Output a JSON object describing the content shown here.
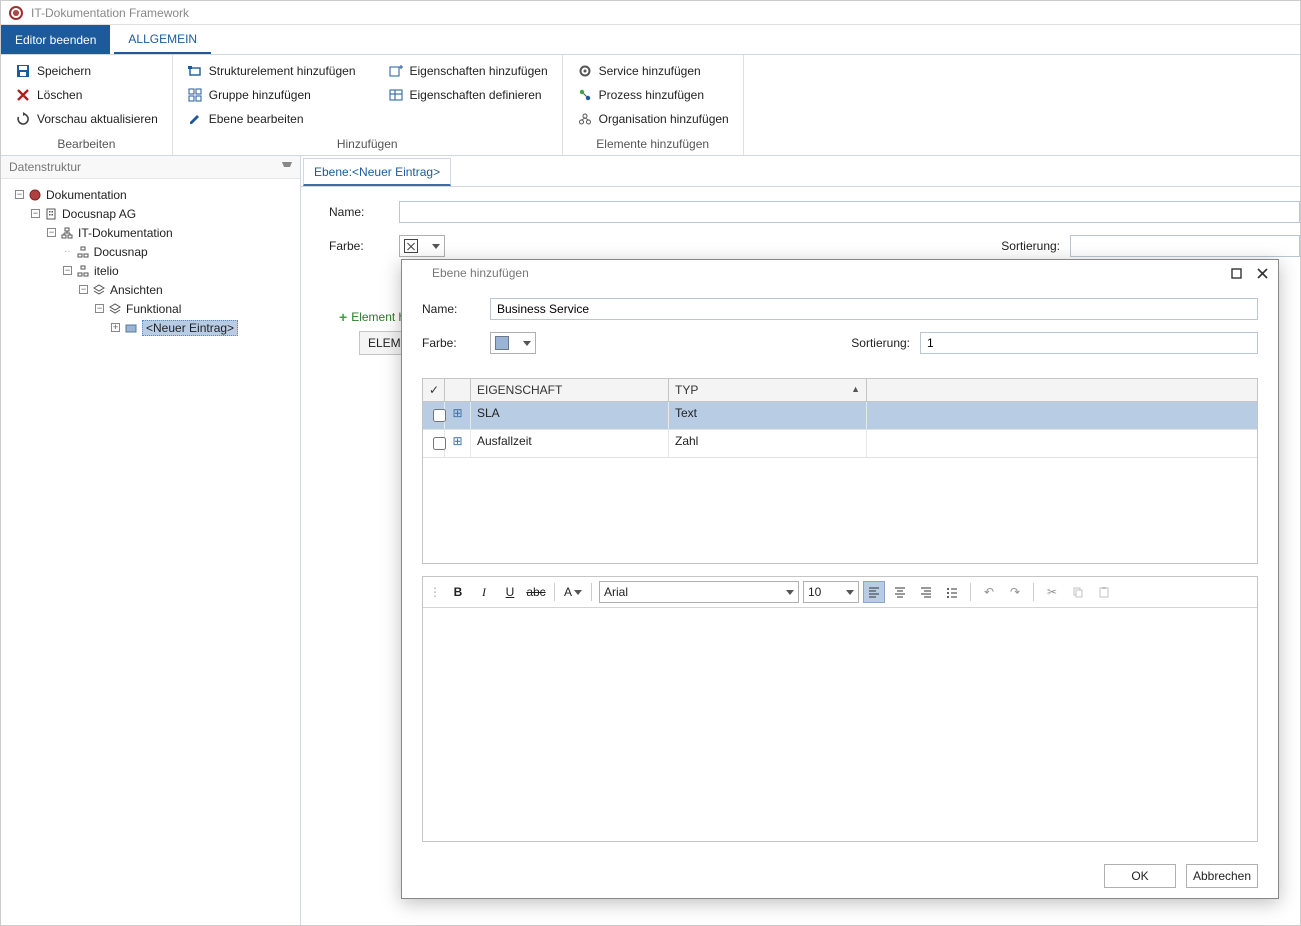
{
  "app_title": "IT-Dokumentation Framework",
  "tabs": {
    "editor_exit": "Editor beenden",
    "general": "ALLGEMEIN"
  },
  "ribbon": {
    "edit_group": {
      "label": "Bearbeiten",
      "save": "Speichern",
      "delete": "Löschen",
      "refresh_preview": "Vorschau aktualisieren"
    },
    "add_group": {
      "label": "Hinzufügen",
      "add_structure": "Strukturelement hinzufügen",
      "add_group_item": "Gruppe hinzufügen",
      "edit_layer": "Ebene bearbeiten",
      "add_properties": "Eigenschaften hinzufügen",
      "define_properties": "Eigenschaften definieren"
    },
    "elements_group": {
      "label": "Elemente hinzufügen",
      "add_service": "Service hinzufügen",
      "add_process": "Prozess hinzufügen",
      "add_org": "Organisation hinzufügen"
    }
  },
  "sidebar": {
    "title": "Datenstruktur",
    "tree": {
      "root": "Dokumentation",
      "company": "Docusnap AG",
      "itdoc": "IT-Dokumentation",
      "docusnap": "Docusnap",
      "itelio": "itelio",
      "views": "Ansichten",
      "functional": "Funktional",
      "new_entry": "<Neuer Eintrag>"
    }
  },
  "editor": {
    "tab_label_prefix": "Ebene: ",
    "tab_entry": "<Neuer Eintrag>",
    "name_label": "Name:",
    "color_label": "Farbe:",
    "sort_label": "Sortierung:",
    "add_element": "Element hinzufügen",
    "grid_col": "ELEMENT"
  },
  "dialog": {
    "title": "Ebene hinzufügen",
    "name_label": "Name:",
    "name_value": "Business Service",
    "color_label": "Farbe:",
    "sort_label": "Sortierung:",
    "sort_value": "1",
    "table": {
      "col_property": "EIGENSCHAFT",
      "col_type": "TYP",
      "rows": [
        {
          "property": "SLA",
          "type": "Text",
          "selected": true
        },
        {
          "property": "Ausfallzeit",
          "type": "Zahl",
          "selected": false
        }
      ]
    },
    "rte": {
      "font": "Arial",
      "size": "10"
    },
    "ok": "OK",
    "cancel": "Abbrechen"
  }
}
